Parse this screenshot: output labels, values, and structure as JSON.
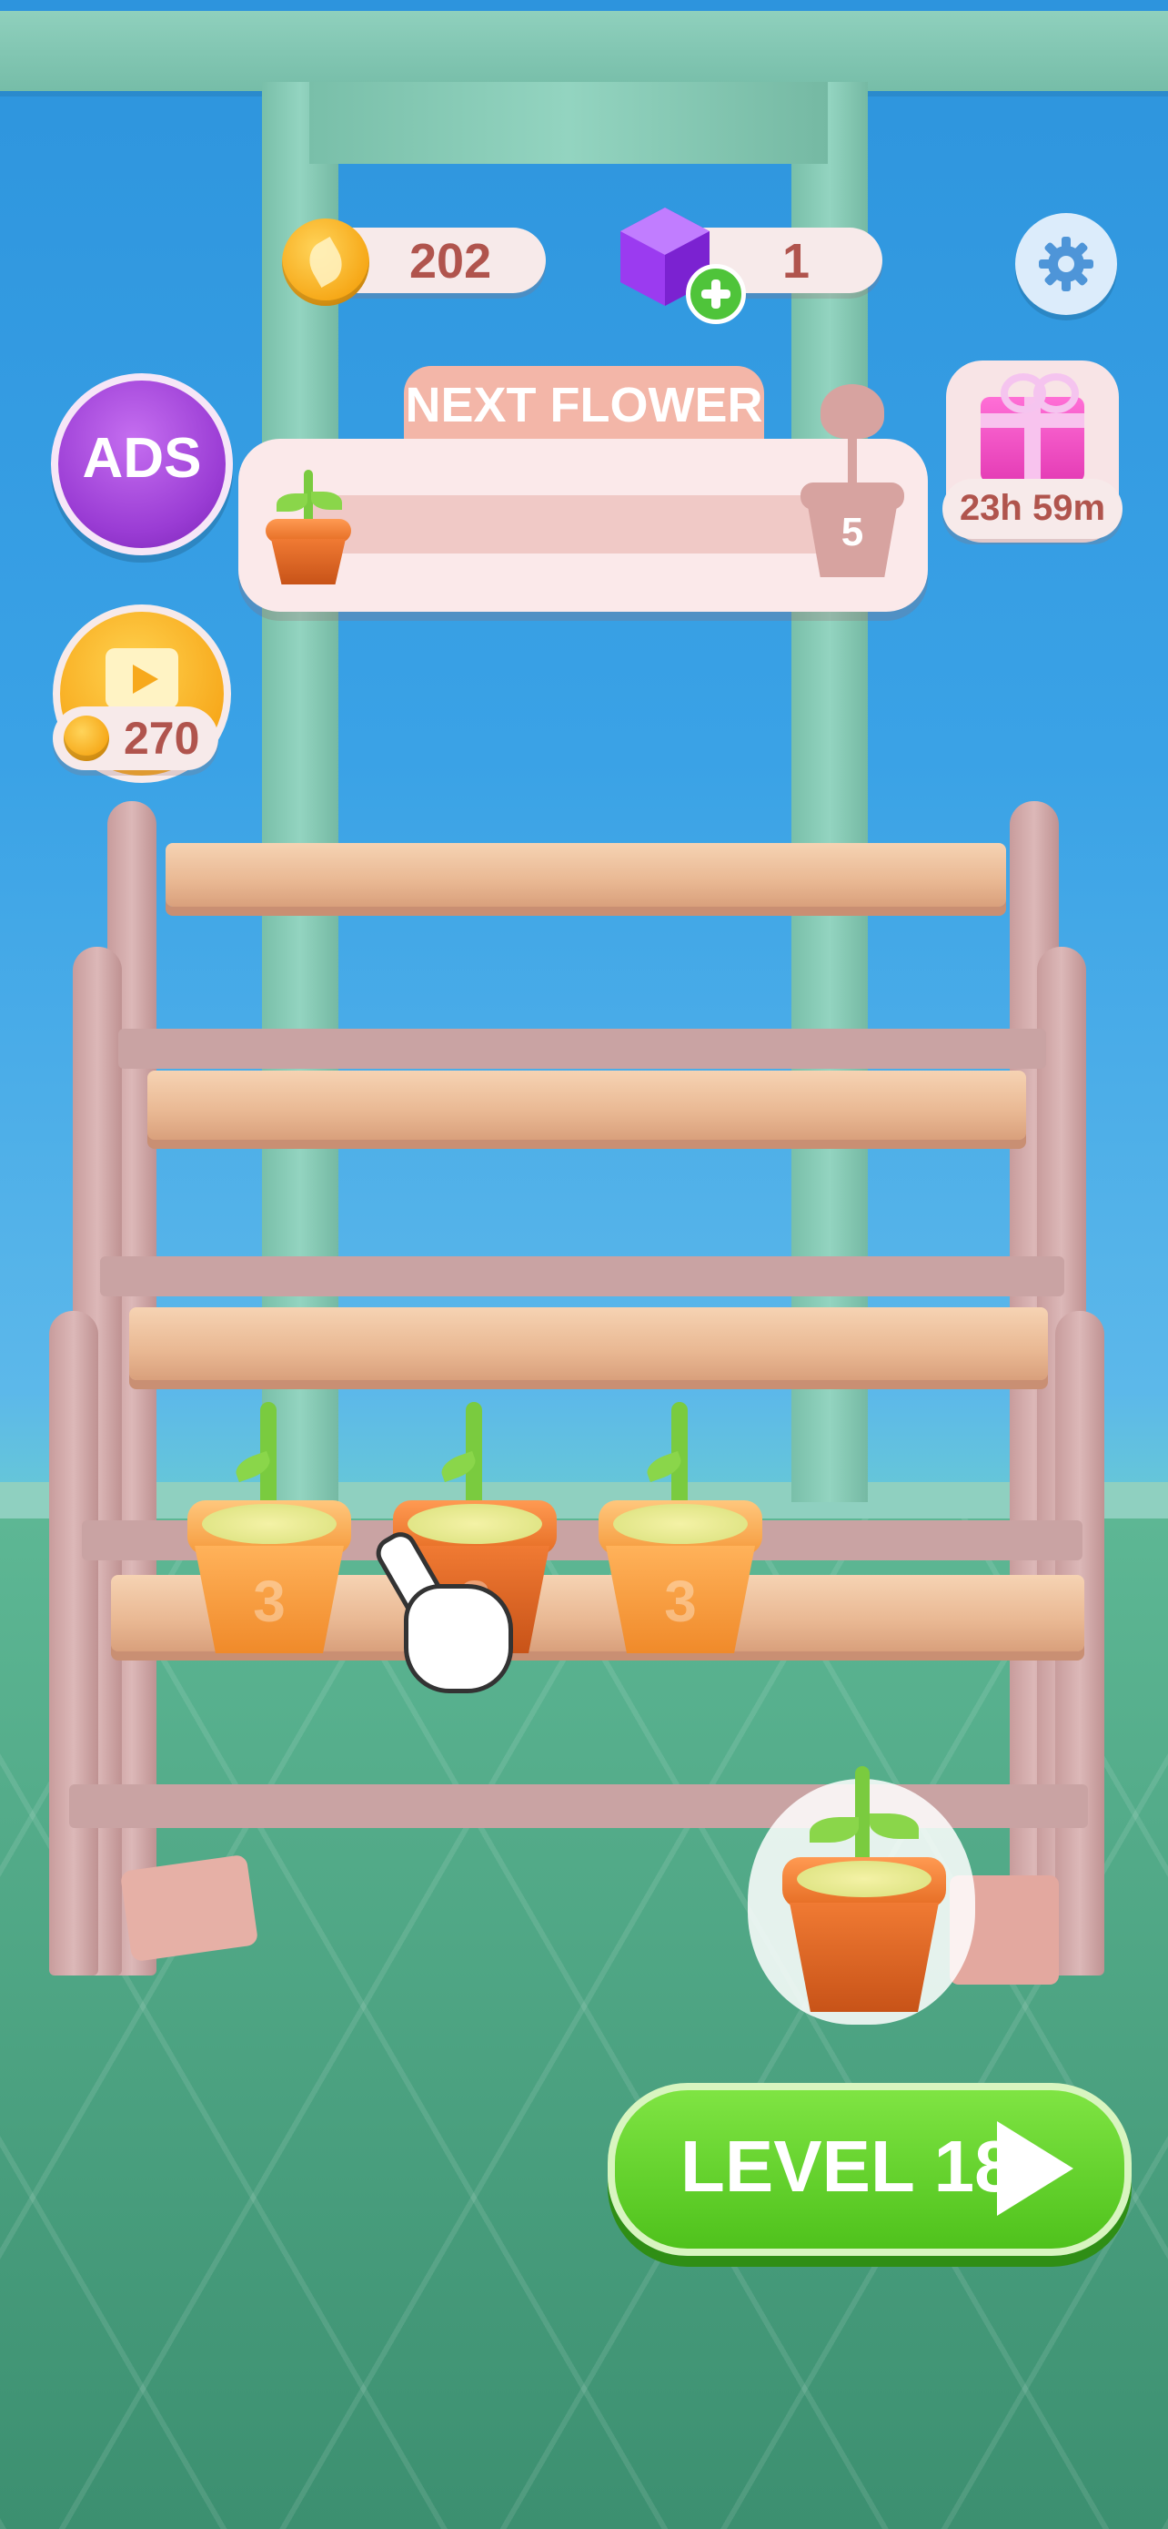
{
  "currency": {
    "coins": "202",
    "gems": "1"
  },
  "next_flower": {
    "label": "NEXT FLOWER",
    "target_count": "5",
    "progress": 0.0
  },
  "ads_button": {
    "label": "ADS"
  },
  "video_reward": {
    "amount": "270"
  },
  "gift": {
    "timer": "23h 59m"
  },
  "shelf": {
    "pots": [
      {
        "number": "3"
      },
      {
        "number": "3"
      },
      {
        "number": "3"
      }
    ]
  },
  "play_button": {
    "label": "LEVEL 18"
  },
  "colors": {
    "play_green": "#5fd12b",
    "accent_pink": "#f6a3a3",
    "ads_purple": "#9b42c9"
  },
  "icons": [
    "coin-leaf-icon",
    "gem-icon",
    "plus-icon",
    "gear-icon",
    "gift-icon",
    "video-icon",
    "play-icon",
    "hand-pointer-icon"
  ]
}
